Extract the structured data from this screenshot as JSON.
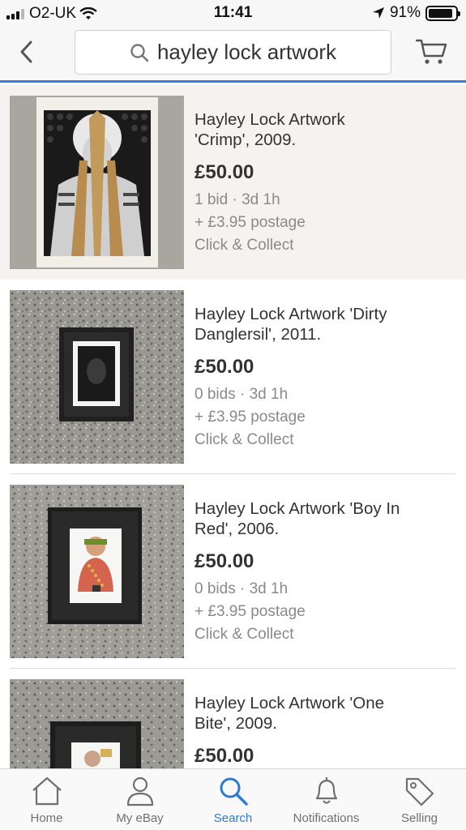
{
  "status_bar": {
    "carrier": "O2-UK",
    "time": "11:41",
    "battery": "91%",
    "battery_level": 0.91
  },
  "header": {
    "back_icon": "chevron-left-icon",
    "search_icon": "search-icon",
    "search_query": "hayley lock artwork",
    "cart_icon": "cart-icon"
  },
  "listings": [
    {
      "title_line1": "Hayley Lock Artwork",
      "title_line2": "'Crimp', 2009.",
      "price": "£50.00",
      "bids": "1 bid · 3d 1h",
      "postage": "+ £3.95 postage",
      "collect": "Click & Collect"
    },
    {
      "title_line1": "Hayley Lock Artwork 'Dirty",
      "title_line2": "Danglersil', 2011.",
      "price": "£50.00",
      "bids": "0 bids · 3d 1h",
      "postage": "+ £3.95 postage",
      "collect": "Click & Collect"
    },
    {
      "title_line1": "Hayley Lock Artwork 'Boy In",
      "title_line2": "Red', 2006.",
      "price": "£50.00",
      "bids": "0 bids · 3d 1h",
      "postage": "+ £3.95 postage",
      "collect": "Click & Collect"
    },
    {
      "title_line1": "Hayley Lock Artwork 'One",
      "title_line2": "Bite', 2009.",
      "price": "£50.00"
    }
  ],
  "tabs": [
    {
      "label": "Home",
      "icon": "home-icon"
    },
    {
      "label": "My eBay",
      "icon": "user-icon"
    },
    {
      "label": "Search",
      "icon": "search-icon",
      "active": true
    },
    {
      "label": "Notifications",
      "icon": "bell-icon"
    },
    {
      "label": "Selling",
      "icon": "tag-icon"
    }
  ],
  "colors": {
    "accent": "#2e7ad6",
    "header_underline": "#3a7bd5"
  }
}
